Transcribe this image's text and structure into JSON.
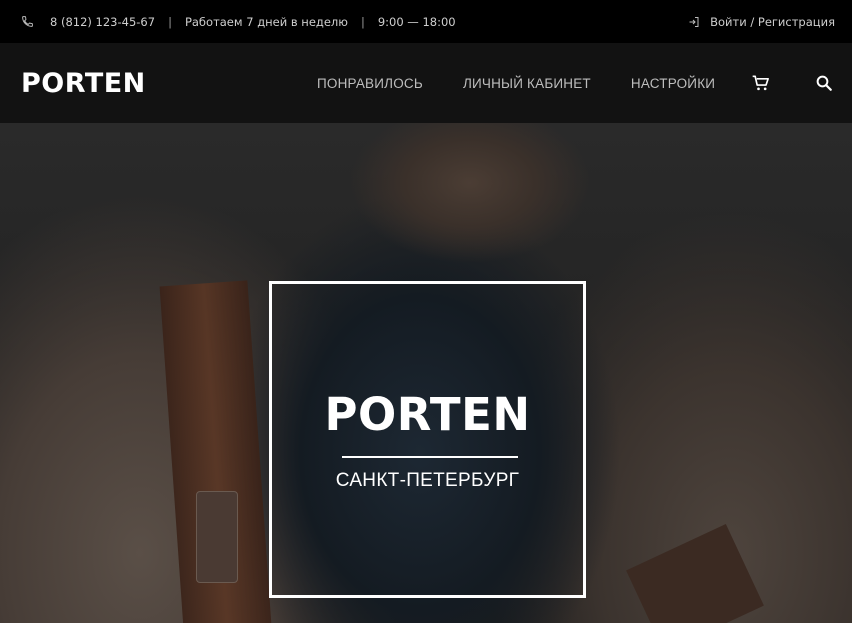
{
  "topbar": {
    "phone": "8 (812) 123-45-67",
    "separator": "|",
    "hours_label": "Работаем 7 дней в неделю",
    "hours": "9:00 — 18:00",
    "login": "Войти / Регистрация",
    "icons": {
      "phone": "phone-icon",
      "login": "login-icon"
    }
  },
  "header": {
    "logo": "PORTEN",
    "nav": [
      "ПОНРАВИЛОСЬ",
      "ЛИЧНЫЙ КАБИНЕТ",
      "НАСТРОЙКИ"
    ],
    "icons": {
      "cart": "cart-icon",
      "search": "search-icon"
    }
  },
  "hero": {
    "logo": "PORTEN",
    "city": "САНКТ-ПЕТЕРБУРГ"
  },
  "colors": {
    "topbar_bg": "#000000",
    "navbar_bg": "#121212",
    "text_light": "#ffffff",
    "nav_text": "#bdbdbd"
  }
}
